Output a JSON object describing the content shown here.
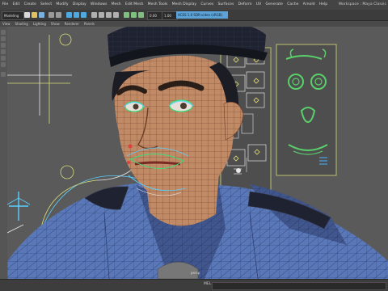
{
  "app": {
    "workspace": "Workspace : Maya Classic"
  },
  "menubar": {
    "items": [
      "File",
      "Edit",
      "Create",
      "Select",
      "Modify",
      "Display",
      "Windows",
      "Mesh",
      "Edit Mesh",
      "Mesh Tools",
      "Mesh Display",
      "Curves",
      "Surfaces",
      "Deform",
      "UV",
      "Generate",
      "Cache",
      "Arnold",
      "Help"
    ]
  },
  "statusline": {
    "menuset": "Modeling",
    "field1": "0.00",
    "field2": "1.00",
    "colorspace": "ACES 1.0 SDR-video (sRGB)"
  },
  "panels": {
    "items": [
      "View",
      "Shading",
      "Lighting",
      "Show",
      "Renderer",
      "Panels"
    ]
  },
  "viewport": {
    "camera_label": "persp",
    "colors": {
      "background": "#5a5a5a",
      "wire_uv": "#d8dc7a",
      "wire_blue": "#5ad0ff",
      "wire_green": "#35e07a",
      "face_ctrl": "#e6e07a"
    }
  },
  "commandline": {
    "mel_label": "MEL"
  }
}
